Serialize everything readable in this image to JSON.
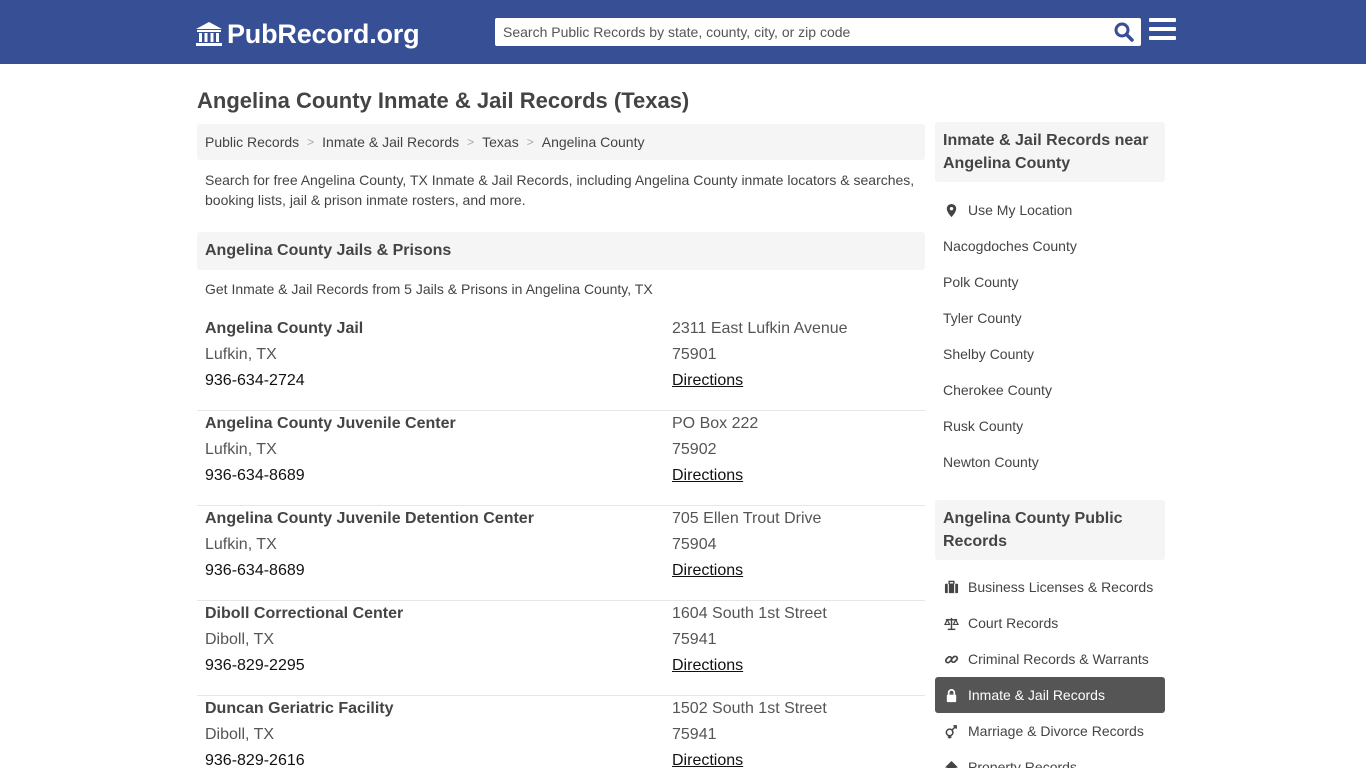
{
  "header": {
    "logo_text": "PubRecord.org",
    "search_placeholder": "Search Public Records by state, county, city, or zip code",
    "icons": {
      "logo": "courthouse-icon",
      "search": "search-icon",
      "menu": "hamburger-menu-icon"
    }
  },
  "page": {
    "title": "Angelina County Inmate & Jail Records (Texas)",
    "breadcrumb": [
      "Public Records",
      "Inmate & Jail Records",
      "Texas",
      "Angelina County"
    ],
    "intro": "Search for free Angelina County, TX Inmate & Jail Records, including Angelina County inmate locators & searches, booking lists, jail & prison inmate rosters, and more."
  },
  "section": {
    "title": "Angelina County Jails & Prisons",
    "subtitle": "Get Inmate & Jail Records from 5 Jails & Prisons in Angelina County, TX"
  },
  "facilities": [
    {
      "name": "Angelina County Jail",
      "city": "Lufkin, TX",
      "phone": "936-634-2724",
      "address": "2311 East Lufkin Avenue",
      "zip": "75901",
      "directions": "Directions"
    },
    {
      "name": "Angelina County Juvenile Center",
      "city": "Lufkin, TX",
      "phone": "936-634-8689",
      "address": "PO Box 222",
      "zip": "75902",
      "directions": "Directions"
    },
    {
      "name": "Angelina County Juvenile Detention Center",
      "city": "Lufkin, TX",
      "phone": "936-634-8689",
      "address": "705 Ellen Trout Drive",
      "zip": "75904",
      "directions": "Directions"
    },
    {
      "name": "Diboll Correctional Center",
      "city": "Diboll, TX",
      "phone": "936-829-2295",
      "address": "1604 South 1st Street",
      "zip": "75941",
      "directions": "Directions"
    },
    {
      "name": "Duncan Geriatric Facility",
      "city": "Diboll, TX",
      "phone": "936-829-2616",
      "address": "1502 South 1st Street",
      "zip": "75941",
      "directions": "Directions"
    }
  ],
  "sidebar": {
    "nearby_title": "Inmate & Jail Records near Angelina County",
    "use_location": "Use My Location",
    "nearby": [
      "Nacogdoches County",
      "Polk County",
      "Tyler County",
      "Shelby County",
      "Cherokee County",
      "Rusk County",
      "Newton County"
    ],
    "public_title": "Angelina County Public Records",
    "public_records": [
      {
        "label": "Business Licenses & Records",
        "icon": "briefcase-icon"
      },
      {
        "label": "Court Records",
        "icon": "scales-icon"
      },
      {
        "label": "Criminal Records & Warrants",
        "icon": "link-icon"
      },
      {
        "label": "Inmate & Jail Records",
        "icon": "lock-icon",
        "active": true
      },
      {
        "label": "Marriage & Divorce Records",
        "icon": "gender-icon"
      },
      {
        "label": "Property Records",
        "icon": "home-icon"
      }
    ]
  },
  "colors": {
    "header_bg": "#364f95",
    "panel_bg": "#f5f5f5",
    "active_bg": "#555555",
    "search_icon": "#364f95"
  }
}
